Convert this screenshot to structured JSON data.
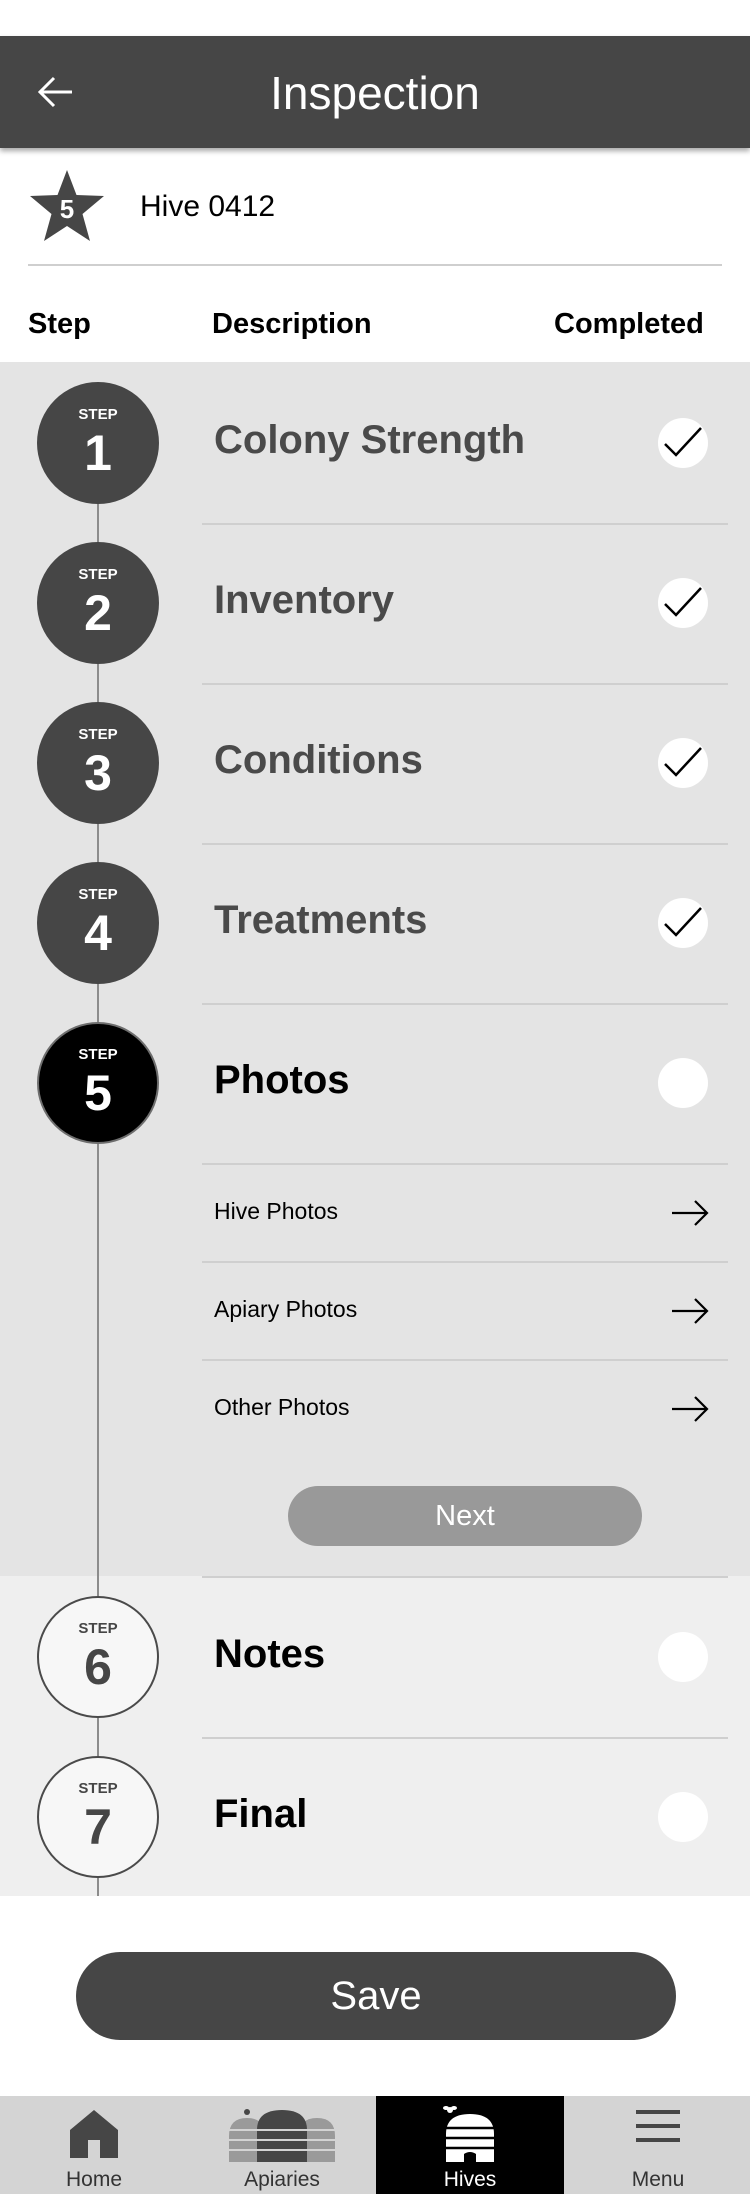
{
  "header": {
    "title": "Inspection",
    "back_icon": "arrow-left-icon"
  },
  "hive": {
    "badge_number": "5",
    "name": "Hive 0412"
  },
  "columns": {
    "step": "Step",
    "description": "Description",
    "completed": "Completed"
  },
  "steps": [
    {
      "label": "STEP",
      "number": "1",
      "title": "Colony Strength",
      "completed": true
    },
    {
      "label": "STEP",
      "number": "2",
      "title": "Inventory",
      "completed": true
    },
    {
      "label": "STEP",
      "number": "3",
      "title": "Conditions",
      "completed": true
    },
    {
      "label": "STEP",
      "number": "4",
      "title": "Treatments",
      "completed": true
    },
    {
      "label": "STEP",
      "number": "5",
      "title": "Photos",
      "completed": false,
      "sub_items": [
        "Hive Photos",
        "Apiary Photos",
        "Other Photos"
      ],
      "next_label": "Next"
    },
    {
      "label": "STEP",
      "number": "6",
      "title": "Notes",
      "completed": false
    },
    {
      "label": "STEP",
      "number": "7",
      "title": "Final",
      "completed": false
    }
  ],
  "save_label": "Save",
  "tabs": [
    {
      "label": "Home",
      "icon": "home-icon",
      "active": false
    },
    {
      "label": "Apiaries",
      "icon": "beehives-icon",
      "active": false
    },
    {
      "label": "Hives",
      "icon": "beehive-icon",
      "active": true
    },
    {
      "label": "Menu",
      "icon": "hamburger-menu-icon",
      "active": false
    }
  ],
  "colors": {
    "header": "#464646",
    "completed_bg": "#e4e4e4",
    "pending_bg": "#efefef",
    "active_step": "#000000"
  }
}
